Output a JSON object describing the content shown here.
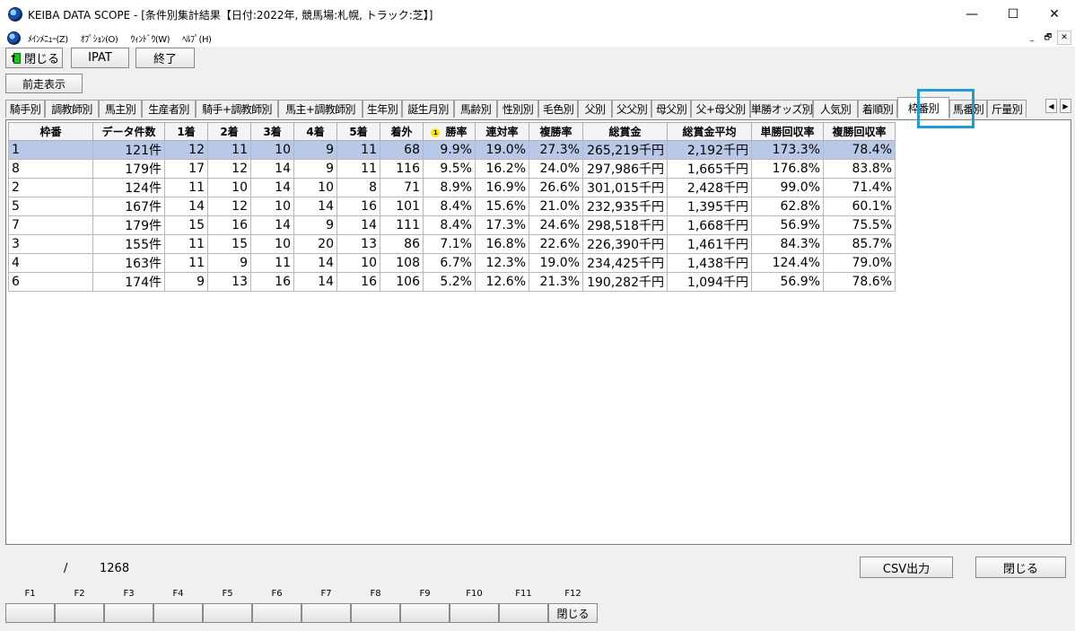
{
  "window": {
    "title": "KEIBA DATA SCOPE - [条件別集計結果【日付:2022年, 競馬場:札幌, トラック:芝】]",
    "minimize": "—",
    "maximize": "☐",
    "close": "✕"
  },
  "menu": {
    "items": [
      "ﾒｲﾝﾒﾆｭｰ(Z)",
      "ｵﾌﾟｼｮﾝ(O)",
      "ｳｨﾝﾄﾞｳ(W)",
      "ﾍﾙﾌﾟ(H)"
    ],
    "mdi_minimize": "_",
    "mdi_restore": "🗗",
    "mdi_close": "✕"
  },
  "toolbar": {
    "close_label": "閉じる",
    "ipat_label": "IPAT",
    "exit_label": "終了"
  },
  "prev_button": "前走表示",
  "tabs": [
    "騎手別",
    "調教師別",
    "馬主別",
    "生産者別",
    "騎手+調教師別",
    "馬主+調教師別",
    "生年別",
    "誕生月別",
    "馬齢別",
    "性別別",
    "毛色別",
    "父別",
    "父父別",
    "母父別",
    "父+母父別",
    "単勝オッズ別",
    "人気別",
    "着順別",
    "枠番別",
    "馬番別",
    "斤量別"
  ],
  "active_tab": "枠番別",
  "tab_scroll": {
    "left": "◀",
    "right": "▶"
  },
  "table": {
    "sort_badge": "1",
    "headers": [
      "枠番",
      "データ件数",
      "1着",
      "2着",
      "3着",
      "4着",
      "5着",
      "着外",
      "勝率",
      "連対率",
      "複勝率",
      "総賞金",
      "総賞金平均",
      "単勝回収率",
      "複勝回収率"
    ],
    "rows": [
      [
        "1",
        "121件",
        "12",
        "11",
        "10",
        "9",
        "11",
        "68",
        "9.9%",
        "19.0%",
        "27.3%",
        "265,219千円",
        "2,192千円",
        "173.3%",
        "78.4%"
      ],
      [
        "8",
        "179件",
        "17",
        "12",
        "14",
        "9",
        "11",
        "116",
        "9.5%",
        "16.2%",
        "24.0%",
        "297,986千円",
        "1,665千円",
        "176.8%",
        "83.8%"
      ],
      [
        "2",
        "124件",
        "11",
        "10",
        "14",
        "10",
        "8",
        "71",
        "8.9%",
        "16.9%",
        "26.6%",
        "301,015千円",
        "2,428千円",
        "99.0%",
        "71.4%"
      ],
      [
        "5",
        "167件",
        "14",
        "12",
        "10",
        "14",
        "16",
        "101",
        "8.4%",
        "15.6%",
        "21.0%",
        "232,935千円",
        "1,395千円",
        "62.8%",
        "60.1%"
      ],
      [
        "7",
        "179件",
        "15",
        "16",
        "14",
        "9",
        "14",
        "111",
        "8.4%",
        "17.3%",
        "24.6%",
        "298,518千円",
        "1,668千円",
        "56.9%",
        "75.5%"
      ],
      [
        "3",
        "155件",
        "11",
        "15",
        "10",
        "20",
        "13",
        "86",
        "7.1%",
        "16.8%",
        "22.6%",
        "226,390千円",
        "1,461千円",
        "84.3%",
        "85.7%"
      ],
      [
        "4",
        "163件",
        "11",
        "9",
        "11",
        "14",
        "10",
        "108",
        "6.7%",
        "12.3%",
        "19.0%",
        "234,425千円",
        "1,438千円",
        "124.4%",
        "79.0%"
      ],
      [
        "6",
        "174件",
        "9",
        "13",
        "16",
        "14",
        "16",
        "106",
        "5.2%",
        "12.6%",
        "21.3%",
        "190,282千円",
        "1,094千円",
        "56.9%",
        "78.6%"
      ]
    ]
  },
  "status": {
    "separator": "/",
    "total": "1268"
  },
  "bottom_buttons": {
    "csv_label": "CSV出力",
    "close_label": "閉じる"
  },
  "fkeys": {
    "labels": [
      "F1",
      "F2",
      "F3",
      "F4",
      "F5",
      "F6",
      "F7",
      "F8",
      "F9",
      "F10",
      "F11",
      "F12"
    ],
    "f12_label": "閉じる"
  },
  "colors": {
    "selected_row": "#b8c8e6",
    "tab_highlight": "#1e9bd8",
    "sort_badge": "#ffe800"
  }
}
